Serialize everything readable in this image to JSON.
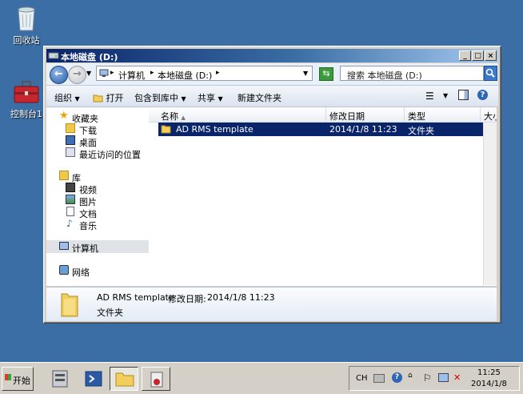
{
  "desktop": {
    "recycle_bin_label": "回收站",
    "control_panel_label": "控制台1"
  },
  "window": {
    "title": "本地磁盘 (D:)",
    "address": {
      "crumb1": "计算机",
      "crumb2": "本地磁盘 (D:)"
    },
    "search_placeholder": "搜索 本地磁盘 (D:)",
    "toolbar": {
      "organize": "组织",
      "open": "打开",
      "include_in_library": "包含到库中",
      "share": "共享",
      "new_folder": "新建文件夹"
    },
    "nav": {
      "favorites": "收藏夹",
      "downloads": "下载",
      "desktop": "桌面",
      "recent": "最近访问的位置",
      "libraries": "库",
      "videos": "视频",
      "pictures": "图片",
      "documents": "文档",
      "music": "音乐",
      "computer": "计算机",
      "network": "网络"
    },
    "columns": {
      "name": "名称",
      "modified": "修改日期",
      "type": "类型",
      "size": "大小"
    },
    "rows": [
      {
        "name": "AD RMS template",
        "modified": "2014/1/8 11:23",
        "type": "文件夹"
      }
    ],
    "details": {
      "name": "AD RMS template",
      "modified_label": "修改日期:",
      "modified": "2014/1/8 11:23",
      "type": "文件夹"
    }
  },
  "taskbar": {
    "start_label": "开始",
    "lang": "CH",
    "time": "11:25",
    "date": "2014/1/8"
  }
}
